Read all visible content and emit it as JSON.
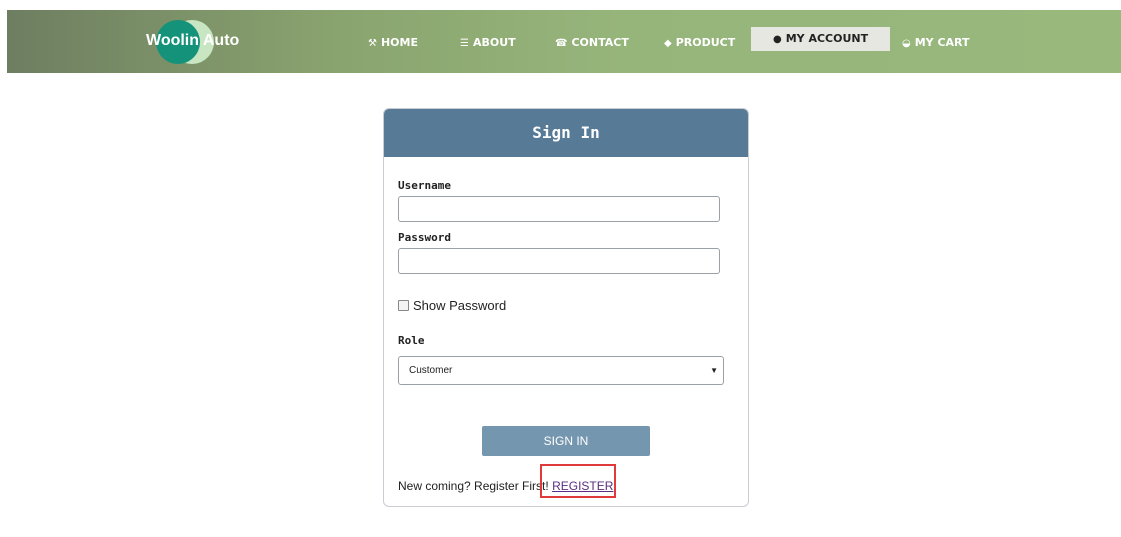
{
  "brand": {
    "name": "Woolin Auto",
    "colors": {
      "navbar": "#96b57b",
      "header": "#577a97",
      "button": "#7596af",
      "highlight": "#e03a3a"
    }
  },
  "nav": {
    "items": [
      {
        "label": "HOME",
        "icon": "wrench-icon",
        "glyph": "⚒"
      },
      {
        "label": "ABOUT",
        "icon": "document-icon",
        "glyph": "☰"
      },
      {
        "label": "CONTACT",
        "icon": "phone-icon",
        "glyph": "☎"
      },
      {
        "label": "PRODUCT",
        "icon": "tag-icon",
        "glyph": "◆"
      },
      {
        "label": "MY ACCOUNT",
        "icon": "user-circle-icon",
        "glyph": "●",
        "active": true
      },
      {
        "label": "MY CART",
        "icon": "basket-icon",
        "glyph": "◒"
      }
    ]
  },
  "form": {
    "title": "Sign In",
    "username_label": "Username",
    "username_value": "",
    "password_label": "Password",
    "password_value": "",
    "show_password_label": "Show Password",
    "show_password_checked": false,
    "role_label": "Role",
    "role_selected": "Customer",
    "submit_label": "SIGN IN",
    "register_prompt": "New coming? Register First!",
    "register_link": "REGISTER"
  }
}
